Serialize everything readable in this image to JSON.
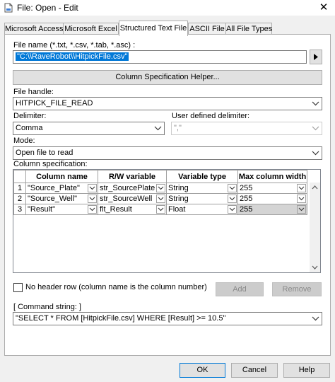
{
  "window": {
    "title": "File: Open - Edit",
    "close_glyph": "✕"
  },
  "tabs": [
    {
      "label": "Microsoft Access"
    },
    {
      "label": "Microsoft Excel"
    },
    {
      "label": "Structured Text File"
    },
    {
      "label": "ASCII File"
    },
    {
      "label": "All File Types"
    }
  ],
  "file_name": {
    "label": "File name (*.txt, *.csv, *.tab, *.asc) :",
    "value": "\"C:\\\\RaveRobot\\\\HitpickFile.csv\""
  },
  "column_spec_helper_label": "Column Specification Helper...",
  "file_handle": {
    "label": "File handle:",
    "value": "HITPICK_FILE_READ"
  },
  "delimiter": {
    "label": "Delimiter:",
    "value": "Comma"
  },
  "user_delimiter": {
    "label": "User defined delimiter:",
    "value": "\",\""
  },
  "mode": {
    "label": "Mode:",
    "value": "Open file to read"
  },
  "column_spec": {
    "label": "Column specification:",
    "headers": [
      "Column name",
      "R/W variable",
      "Variable type",
      "Max column width"
    ],
    "rows": [
      {
        "num": "1",
        "name": "\"Source_Plate\"",
        "var": "str_SourcePlate",
        "type": "String",
        "width": "255"
      },
      {
        "num": "2",
        "name": "\"Source_Well\"",
        "var": "str_SourceWell",
        "type": "String",
        "width": "255"
      },
      {
        "num": "3",
        "name": "\"Result\"",
        "var": "flt_Result",
        "type": "Float",
        "width": "255"
      }
    ]
  },
  "no_header": {
    "label": "No header row (column name is the column number)",
    "checked": false
  },
  "add_label": "Add",
  "remove_label": "Remove",
  "command": {
    "label": "[ Command string: ]",
    "value": "\"SELECT * FROM [HitpickFile.csv] WHERE [Result] >= 10.5\""
  },
  "ok_label": "OK",
  "cancel_label": "Cancel",
  "help_label": "Help"
}
